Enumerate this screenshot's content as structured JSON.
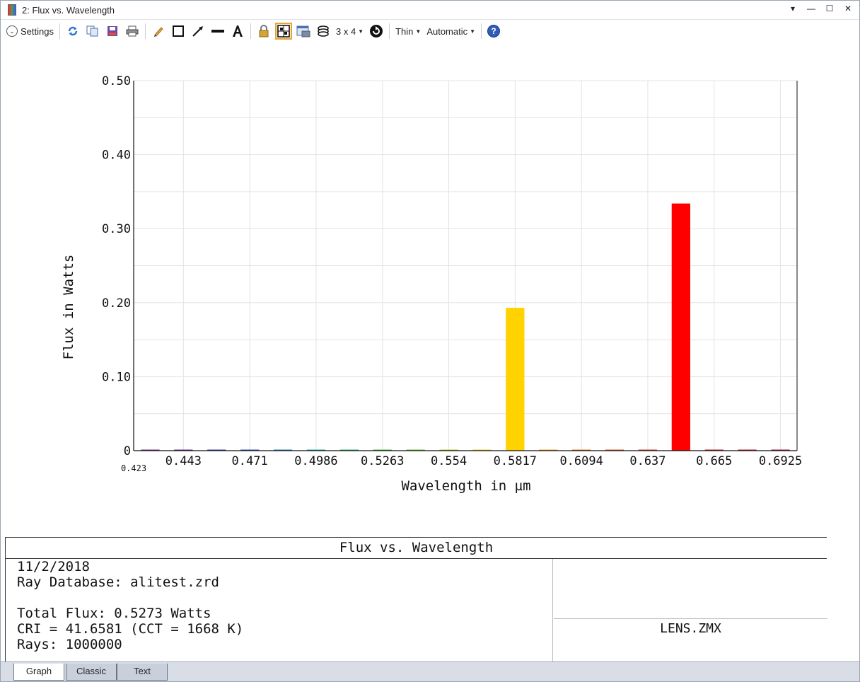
{
  "window": {
    "title": "2: Flux vs. Wavelength",
    "controls": [
      "▾",
      "—",
      "☐",
      "✕"
    ]
  },
  "toolbar": {
    "settings_label": "Settings",
    "layout_label": "3 x 4",
    "line_label": "Thin",
    "scale_label": "Automatic",
    "icons": [
      "refresh-icon",
      "copy-icon",
      "save-icon",
      "print-icon",
      "pencil-icon",
      "rectangle-icon",
      "arrow-icon",
      "line-icon",
      "text-icon",
      "lock-icon",
      "grid-icon",
      "window-icon",
      "layers-icon",
      "rotate-icon",
      "help-icon"
    ]
  },
  "chart_data": {
    "type": "bar",
    "xlabel": "Wavelength in µm",
    "ylabel": "Flux in Watts",
    "ylim": [
      0,
      0.5
    ],
    "y_ticks": [
      "0",
      "0.10",
      "0.20",
      "0.30",
      "0.40",
      "0.50"
    ],
    "x_tick_labels": [
      "0.443",
      "0.471",
      "0.4986",
      "0.5263",
      "0.554",
      "0.5817",
      "0.6094",
      "0.637",
      "0.665",
      "0.6925"
    ],
    "x_start_label": "0.423",
    "grid": true,
    "bars": [
      {
        "color": "#7a2e8e",
        "value": 0.0
      },
      {
        "color": "#5e2fa0",
        "value": 0.0
      },
      {
        "color": "#3d3fb0",
        "value": 0.0
      },
      {
        "color": "#2a58c0",
        "value": 0.0
      },
      {
        "color": "#1f86b8",
        "value": 0.0
      },
      {
        "color": "#23a9a0",
        "value": 0.0
      },
      {
        "color": "#2db86a",
        "value": 0.0
      },
      {
        "color": "#3dbf3a",
        "value": 0.0
      },
      {
        "color": "#6cc42a",
        "value": 0.0
      },
      {
        "color": "#a8cc22",
        "value": 0.0
      },
      {
        "color": "#e6cc1c",
        "value": 0.0
      },
      {
        "color": "#ffd200",
        "value": 0.193
      },
      {
        "color": "#f2a11e",
        "value": 0.0
      },
      {
        "color": "#e8731e",
        "value": 0.0
      },
      {
        "color": "#e0531f",
        "value": 0.0
      },
      {
        "color": "#d8381f",
        "value": 0.0
      },
      {
        "color": "#ff0000",
        "value": 0.334
      },
      {
        "color": "#c81c1c",
        "value": 0.0
      },
      {
        "color": "#b81c2a",
        "value": 0.0
      },
      {
        "color": "#a01c3a",
        "value": 0.0
      }
    ]
  },
  "info": {
    "title": "Flux vs. Wavelength",
    "date": "11/2/2018",
    "database": "Ray Database: alitest.zrd",
    "total_flux": "Total Flux: 0.5273 Watts",
    "cri": "CRI = 41.6581 (CCT = 1668 K)",
    "rays": "Rays: 1000000",
    "file": "LENS.ZMX"
  },
  "tabs": [
    "Graph",
    "Classic",
    "Text"
  ]
}
